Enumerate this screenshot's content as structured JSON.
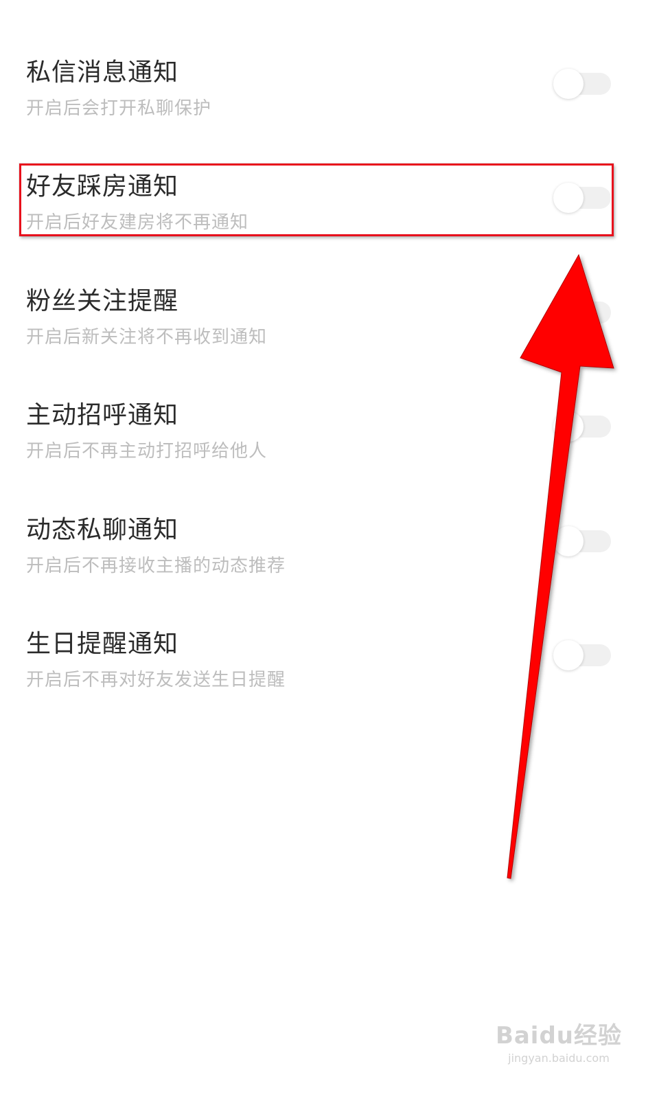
{
  "settings": [
    {
      "title": "私信消息通知",
      "desc": "开启后会打开私聊保护",
      "enabled": false
    },
    {
      "title": "好友踩房通知",
      "desc": "开启后好友建房将不再通知",
      "enabled": false
    },
    {
      "title": "粉丝关注提醒",
      "desc": "开启后新关注将不再收到通知",
      "enabled": false
    },
    {
      "title": "主动招呼通知",
      "desc": "开启后不再主动打招呼给他人",
      "enabled": false
    },
    {
      "title": "动态私聊通知",
      "desc": "开启后不再接收主播的动态推荐",
      "enabled": false
    },
    {
      "title": "生日提醒通知",
      "desc": "开启后不再对好友发送生日提醒",
      "enabled": false
    }
  ],
  "annotation": {
    "highlight_color": "#e8101c",
    "arrow_color": "#ff0000"
  },
  "watermark": {
    "logo": "Baidu经验",
    "site": "jingyan.baidu.com"
  }
}
